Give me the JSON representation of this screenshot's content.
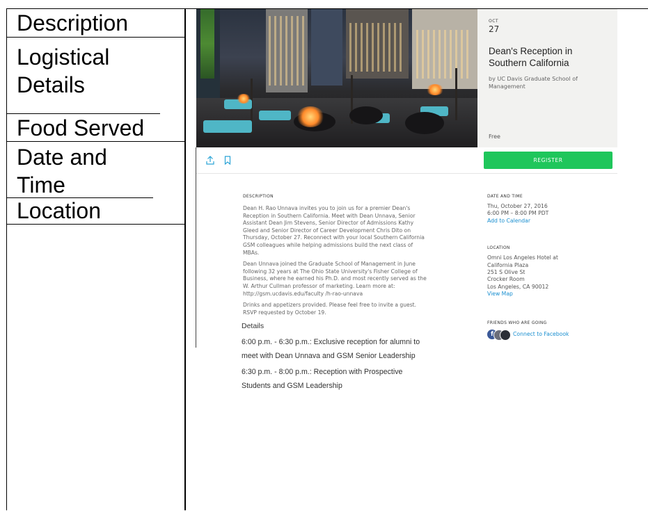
{
  "left_labels": [
    "Description",
    "Logistical Details",
    "Food Served",
    "Date and Time",
    "Location"
  ],
  "event": {
    "month": "OCT",
    "day": "27",
    "title": "Dean's Reception in Southern California",
    "organizer": "by UC Davis Graduate School of Management",
    "price": "Free",
    "register_label": "REGISTER"
  },
  "description": {
    "heading": "DESCRIPTION",
    "paragraphs": [
      "Dean H. Rao Unnava invites you to join us for a premier Dean's Reception in Southern California. Meet with Dean Unnava, Senior Assistant Dean Jim Stevens, Senior Director of Admissions Kathy Gleed and Senior Director of Career Development Chris Dito on Thursday, October 27. Reconnect with your local Southern California GSM colleagues while helping admissions build the next class of MBAs.",
      "Dean Unnava joined the Graduate School of Management in June following 32 years at The Ohio State University's Fisher College of Business, where he earned his Ph.D. and most recently served as the W. Arthur Cullman professor of marketing. Learn more at: http://gsm.ucdavis.edu/faculty /h-rao-unnava",
      "Drinks and appetizers provided. Please feel free to invite a guest. RSVP requested by October 19."
    ],
    "details_heading": "Details",
    "schedule": [
      "6:00 p.m. - 6:30 p.m.: Exclusive reception for alumni to meet with Dean Unnava and GSM Senior Leadership",
      "6:30 p.m. - 8:00 p.m.: Reception with Prospective Students and GSM Leadership"
    ]
  },
  "date_time": {
    "heading": "DATE AND TIME",
    "date": "Thu, October 27, 2016",
    "time": "6:00 PM – 8:00 PM PDT",
    "add_calendar": "Add to Calendar"
  },
  "location": {
    "heading": "LOCATION",
    "lines": [
      "Omni Los Angeles Hotel at",
      "California Plaza",
      "251 S Olive St",
      "Crocker Room",
      "Los Angeles, CA 90012"
    ],
    "view_map": "View Map"
  },
  "friends": {
    "heading": "FRIENDS WHO ARE GOING",
    "connect_label": "Connect to Facebook",
    "facebook_glyph": "f"
  },
  "colors": {
    "register_green": "#1fc65b",
    "link_blue": "#1a8fd0",
    "facebook_blue": "#3b5998"
  }
}
